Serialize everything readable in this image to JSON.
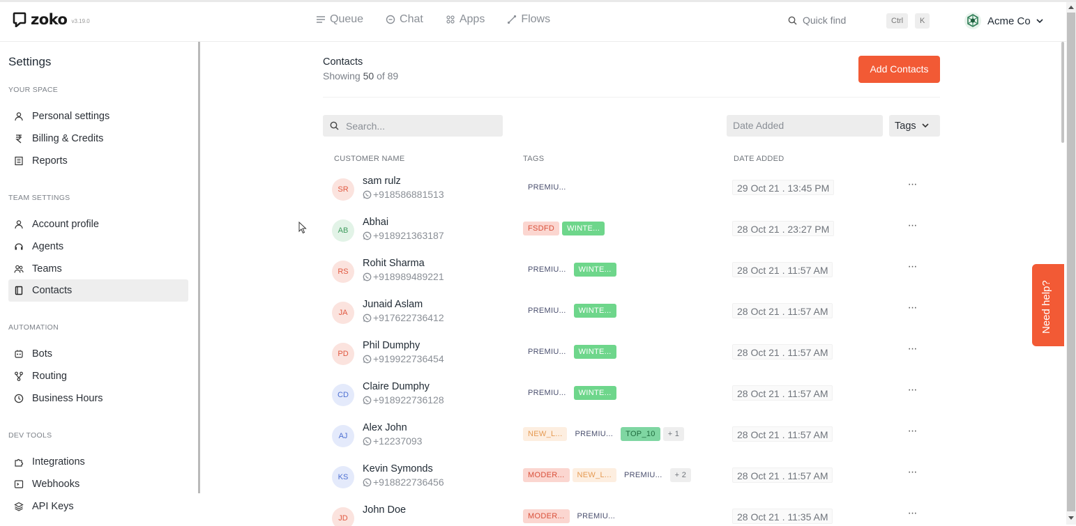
{
  "brand": {
    "name": "zoko",
    "version": "v3.19.0"
  },
  "nav": {
    "items": [
      {
        "label": "Queue",
        "icon": "queue-icon"
      },
      {
        "label": "Chat",
        "icon": "chat-icon"
      },
      {
        "label": "Apps",
        "icon": "apps-icon"
      },
      {
        "label": "Flows",
        "icon": "flows-icon"
      }
    ]
  },
  "quick_find": {
    "label": "Quick find",
    "shortcut_1": "Ctrl",
    "shortcut_2": "K"
  },
  "account": {
    "name": "Acme Co"
  },
  "sidebar": {
    "title": "Settings",
    "sections": [
      {
        "heading": "YOUR SPACE",
        "items": [
          {
            "label": "Personal settings"
          },
          {
            "label": "Billing & Credits"
          },
          {
            "label": "Reports"
          }
        ]
      },
      {
        "heading": "TEAM SETTINGS",
        "items": [
          {
            "label": "Account profile"
          },
          {
            "label": "Agents"
          },
          {
            "label": "Teams"
          },
          {
            "label": "Contacts"
          }
        ]
      },
      {
        "heading": "AUTOMATION",
        "items": [
          {
            "label": "Bots"
          },
          {
            "label": "Routing"
          },
          {
            "label": "Business Hours"
          }
        ]
      },
      {
        "heading": "DEV TOOLS",
        "items": [
          {
            "label": "Integrations"
          },
          {
            "label": "Webhooks"
          },
          {
            "label": "API Keys"
          }
        ]
      }
    ],
    "active_item": "Contacts"
  },
  "contacts": {
    "title": "Contacts",
    "showing_prefix": "Showing",
    "showing_count": "50",
    "showing_suffix": "of 89",
    "add_button": "Add Contacts",
    "search_placeholder": "Search...",
    "date_filter_placeholder": "Date Added",
    "tags_filter": "Tags",
    "columns": {
      "name": "CUSTOMER NAME",
      "tags": "TAGS",
      "date": "DATE ADDED"
    },
    "rows": [
      {
        "initials": "SR",
        "name": "sam rulz",
        "phone": "+918586881513",
        "tags": [
          "PREMIU..."
        ],
        "date": "29 Oct 21 . 13:45 PM",
        "avatar_color": "#e0573f",
        "avatar_bg": "#fbe3de"
      },
      {
        "initials": "AB",
        "name": "Abhai",
        "phone": "+918921363187",
        "tags": [
          "FSDFD",
          "WINTE..."
        ],
        "date": "28 Oct 21 . 23:27 PM",
        "avatar_color": "#3f9b5e",
        "avatar_bg": "#e2f3e7"
      },
      {
        "initials": "RS",
        "name": "Rohit Sharma",
        "phone": "+918989489221",
        "tags": [
          "PREMIU...",
          "WINTE..."
        ],
        "date": "28 Oct 21 . 11:57 AM",
        "avatar_color": "#e0573f",
        "avatar_bg": "#fbe3de"
      },
      {
        "initials": "JA",
        "name": "Junaid Aslam",
        "phone": "+917622736412",
        "tags": [
          "PREMIU...",
          "WINTE..."
        ],
        "date": "28 Oct 21 . 11:57 AM",
        "avatar_color": "#e0573f",
        "avatar_bg": "#fbe3de"
      },
      {
        "initials": "PD",
        "name": "Phil Dumphy",
        "phone": "+919922736454",
        "tags": [
          "PREMIU...",
          "WINTE..."
        ],
        "date": "28 Oct 21 . 11:57 AM",
        "avatar_color": "#e0573f",
        "avatar_bg": "#fbe3de"
      },
      {
        "initials": "CD",
        "name": "Claire Dumphy",
        "phone": "+918922736128",
        "tags": [
          "PREMIU...",
          "WINTE..."
        ],
        "date": "28 Oct 21 . 11:57 AM",
        "avatar_color": "#4d6fd1",
        "avatar_bg": "#e4eafb"
      },
      {
        "initials": "AJ",
        "name": "Alex John",
        "phone": "+12237093",
        "tags": [
          "NEW_L...",
          "PREMIU...",
          "TOP_10",
          "+ 1"
        ],
        "date": "28 Oct 21 . 11:57 AM",
        "avatar_color": "#4d6fd1",
        "avatar_bg": "#e4eafb"
      },
      {
        "initials": "KS",
        "name": "Kevin Symonds",
        "phone": "+918822736456",
        "tags": [
          "MODER...",
          "NEW_L...",
          "PREMIU...",
          "+ 2"
        ],
        "date": "28 Oct 21 . 11:57 AM",
        "avatar_color": "#4d6fd1",
        "avatar_bg": "#e4eafb"
      },
      {
        "initials": "JD",
        "name": "John Doe",
        "phone": "",
        "tags": [
          "MODER...",
          "PREMIU..."
        ],
        "date": "28 Oct 21 . 11:35 AM",
        "avatar_color": "#e0573f",
        "avatar_bg": "#fbe3de"
      }
    ],
    "tag_styles": {
      "PREMIU...": {
        "bg": "#ffffff",
        "fg": "#4a4f6e"
      },
      "WINTE...": {
        "bg": "#6ed68b",
        "fg": "#ffffff"
      },
      "FSDFD": {
        "bg": "#fbd6d0",
        "fg": "#d9503a"
      },
      "NEW_L...": {
        "bg": "#fdeee0",
        "fg": "#e59a52"
      },
      "TOP_10": {
        "bg": "#7fd6a2",
        "fg": "#1f6b3e"
      },
      "MODER...": {
        "bg": "#fbd6d0",
        "fg": "#d9503a"
      },
      "+ 1": {
        "bg": "#eeeeee",
        "fg": "#6f747b"
      },
      "+ 2": {
        "bg": "#eeeeee",
        "fg": "#6f747b"
      }
    },
    "more_label": "···"
  },
  "help": {
    "label": "Need help?"
  },
  "colors": {
    "accent": "#f25a35"
  }
}
